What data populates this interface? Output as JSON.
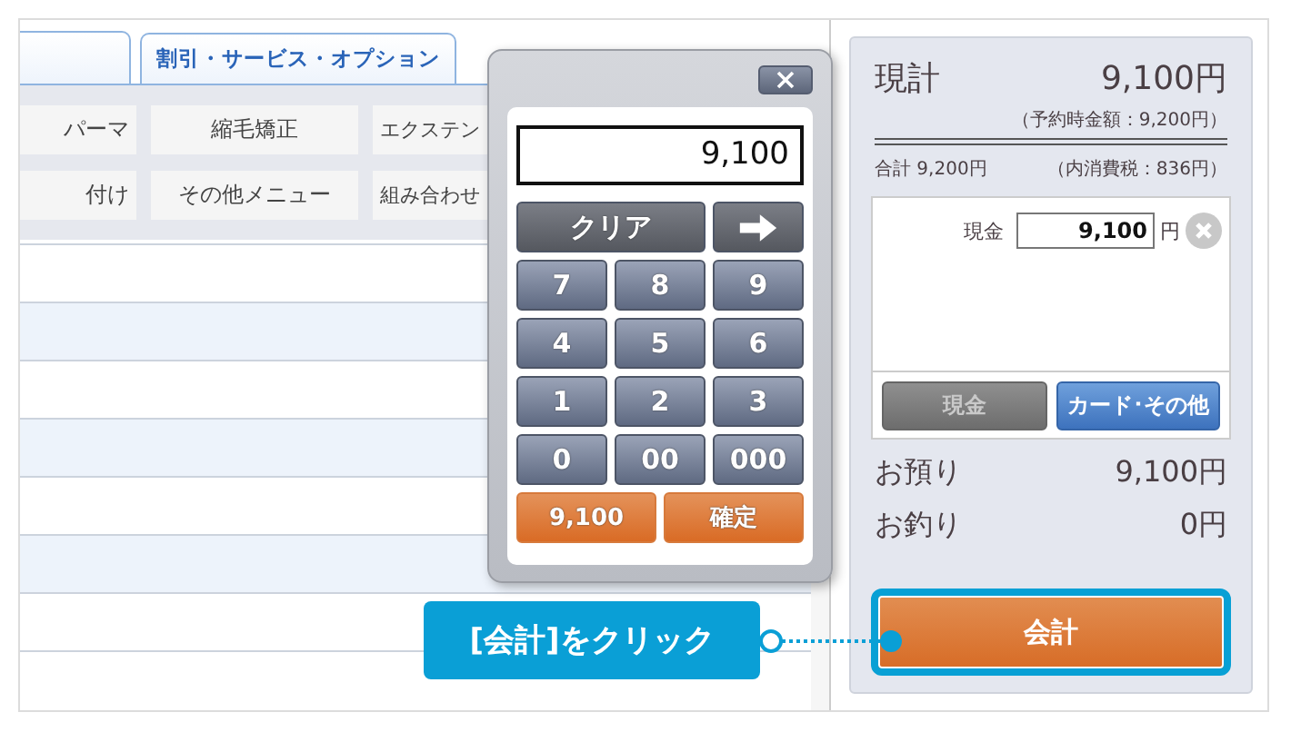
{
  "tabs": [
    {
      "label": "割引・サービス・オプション"
    }
  ],
  "menu_buttons": [
    {
      "label": "パーマ"
    },
    {
      "label": "縮毛矯正"
    },
    {
      "label": "エクステン"
    },
    {
      "label": "付け"
    },
    {
      "label": "その他メニュー"
    },
    {
      "label": "組み合わせ"
    }
  ],
  "calculator": {
    "display": "9,100",
    "keys": [
      {
        "kind": "clear",
        "label": "クリア"
      },
      {
        "kind": "arrow"
      },
      {
        "kind": "digit",
        "label": "7"
      },
      {
        "kind": "digit",
        "label": "8"
      },
      {
        "kind": "digit",
        "label": "9"
      },
      {
        "kind": "digit",
        "label": "4"
      },
      {
        "kind": "digit",
        "label": "5"
      },
      {
        "kind": "digit",
        "label": "6"
      },
      {
        "kind": "digit",
        "label": "1"
      },
      {
        "kind": "digit",
        "label": "2"
      },
      {
        "kind": "digit",
        "label": "3"
      },
      {
        "kind": "digit",
        "label": "0"
      },
      {
        "kind": "digit",
        "label": "00"
      },
      {
        "kind": "digit",
        "label": "000"
      },
      {
        "kind": "amount",
        "label": "9,100"
      },
      {
        "kind": "confirm",
        "label": "確定"
      }
    ]
  },
  "summary": {
    "title": "現計",
    "total": "9,100円",
    "reserved_note": "（予約時金額：9,200円）",
    "subtotal": "合計 9,200円",
    "tax_note": "（内消費税：836円）"
  },
  "payment": {
    "label": "現金",
    "value": "9,100",
    "unit": "円"
  },
  "payment_methods": [
    {
      "label": "現金",
      "disabled": true
    },
    {
      "label": "カード･その他",
      "disabled": false
    }
  ],
  "received": {
    "label": "お預り",
    "value": "9,100円"
  },
  "change": {
    "label": "お釣り",
    "value": "0円"
  },
  "checkout_button": {
    "label": "会計",
    "highlighted": true
  },
  "callout": "[会計]をクリック"
}
